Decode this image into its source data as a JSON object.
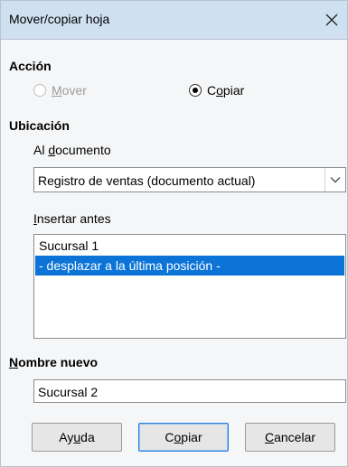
{
  "window": {
    "title": "Mover/copiar hoja"
  },
  "icons": {
    "close": "close-icon",
    "dropdown": "chevron-down-icon"
  },
  "action": {
    "heading": "Acción",
    "options": [
      {
        "pre": "",
        "key": "M",
        "post": "over",
        "selected": false,
        "enabled": false
      },
      {
        "pre": "C",
        "key": "o",
        "post": "piar",
        "selected": true,
        "enabled": true
      }
    ]
  },
  "location": {
    "heading": "Ubicación",
    "document_label": {
      "pre": "Al ",
      "key": "d",
      "post": "ocumento"
    },
    "document_value": "Registro de ventas (documento actual)",
    "insert_before_label": {
      "pre": "",
      "key": "I",
      "post": "nsertar antes"
    },
    "sheets": [
      {
        "label": "Sucursal 1",
        "selected": false
      },
      {
        "label": "- desplazar a la última posición -",
        "selected": true
      }
    ]
  },
  "new_name": {
    "label": {
      "pre": "",
      "key": "N",
      "post": "ombre nuevo"
    },
    "value": "Sucursal 2"
  },
  "buttons": {
    "help": {
      "pre": "Ay",
      "key": "u",
      "post": "da"
    },
    "copy": {
      "pre": "C",
      "key": "o",
      "post": "piar"
    },
    "cancel": {
      "pre": "",
      "key": "C",
      "post": "ancelar"
    }
  },
  "colors": {
    "titlebar": "#cfe0f1",
    "selection": "#0c74d6",
    "dialog_bg": "#f5f6f7"
  }
}
